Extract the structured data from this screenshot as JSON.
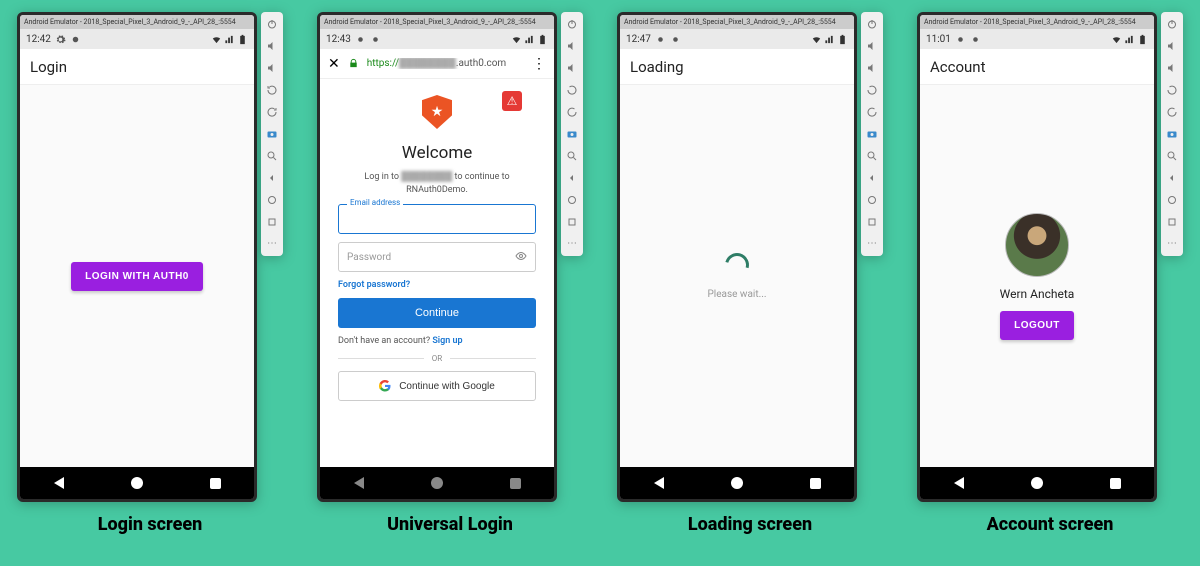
{
  "emulator_title": "Android Emulator - 2018_Special_Pixel_3_Android_9_-_API_28_:5554",
  "sidebar_icons": [
    "power",
    "volume-up",
    "volume-down",
    "rotate-left",
    "rotate-right",
    "camera",
    "zoom-in",
    "back",
    "overview",
    "home",
    "more"
  ],
  "captions": [
    "Login screen",
    "Universal Login",
    "Loading screen",
    "Account screen"
  ],
  "login": {
    "time": "12:42",
    "title": "Login",
    "button": "LOGIN WITH AUTH0"
  },
  "universal": {
    "time": "12:43",
    "url_prefix": "https://",
    "url_suffix": ".auth0.com",
    "welcome": "Welcome",
    "sub_prefix": "Log in to ",
    "sub_suffix": " to continue to RNAuth0Demo.",
    "email_label": "Email address",
    "password_placeholder": "Password",
    "forgot": "Forgot password?",
    "continue": "Continue",
    "no_account": "Don't have an account?  ",
    "sign_up": "Sign up",
    "or": "OR",
    "google": "Continue with Google"
  },
  "loading": {
    "time": "12:47",
    "title": "Loading",
    "text": "Please wait..."
  },
  "account": {
    "time": "11:01",
    "title": "Account",
    "username": "Wern Ancheta",
    "logout": "LOGOUT"
  }
}
